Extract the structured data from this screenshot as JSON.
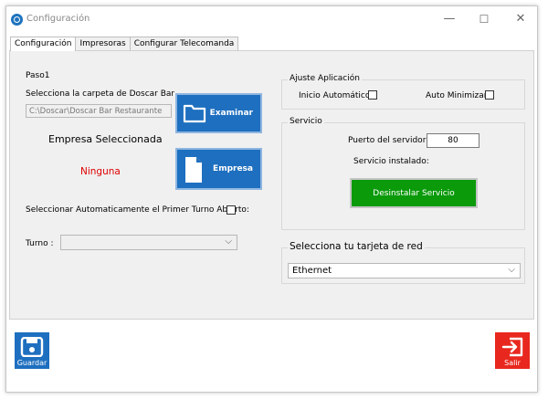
{
  "window": {
    "title": "Configuración",
    "controls": {
      "minimize": "—",
      "maximize": "☐",
      "close": "✕"
    }
  },
  "tabs": [
    {
      "label": "Configuración",
      "active": true
    },
    {
      "label": "Impresoras",
      "active": false
    },
    {
      "label": "Configurar Telecomanda",
      "active": false
    }
  ],
  "paso1": {
    "group_label": "Paso1",
    "folder_prompt": "Selecciona la carpeta de Doscar Bar",
    "folder_path": "C:\\Doscar\\Doscar Bar Restaurante",
    "examinar_label": "Examinar",
    "empresa_title": "Empresa Seleccionada",
    "empresa_value": "Ninguna",
    "empresa_value_color": "#e00000",
    "empresa_label": "Empresa",
    "auto_turno_label": "Seleccionar Automaticamente el Primer Turno Abierto:",
    "turno_label": "Turno :",
    "turno_value": ""
  },
  "ajuste": {
    "group_label": "Ajuste Aplicación",
    "inicio_label": "Inicio Automático:",
    "auto_min_label": "Auto Minimizar:"
  },
  "servicio": {
    "group_label": "Servicio",
    "puerto_label": "Puerto del servidor:",
    "puerto_value": "80",
    "estado_label": "Servicio instalado:",
    "desinstalar_label": "Desinstalar Servicio"
  },
  "red": {
    "group_label": "Selecciona tu tarjeta de red",
    "selected": "Ethernet"
  },
  "footer": {
    "guardar_label": "Guardar",
    "salir_label": "Salir"
  },
  "colors": {
    "tile_blue": "#1e6fbf",
    "green": "#0a9a0a",
    "exit_red": "#e8281e"
  }
}
